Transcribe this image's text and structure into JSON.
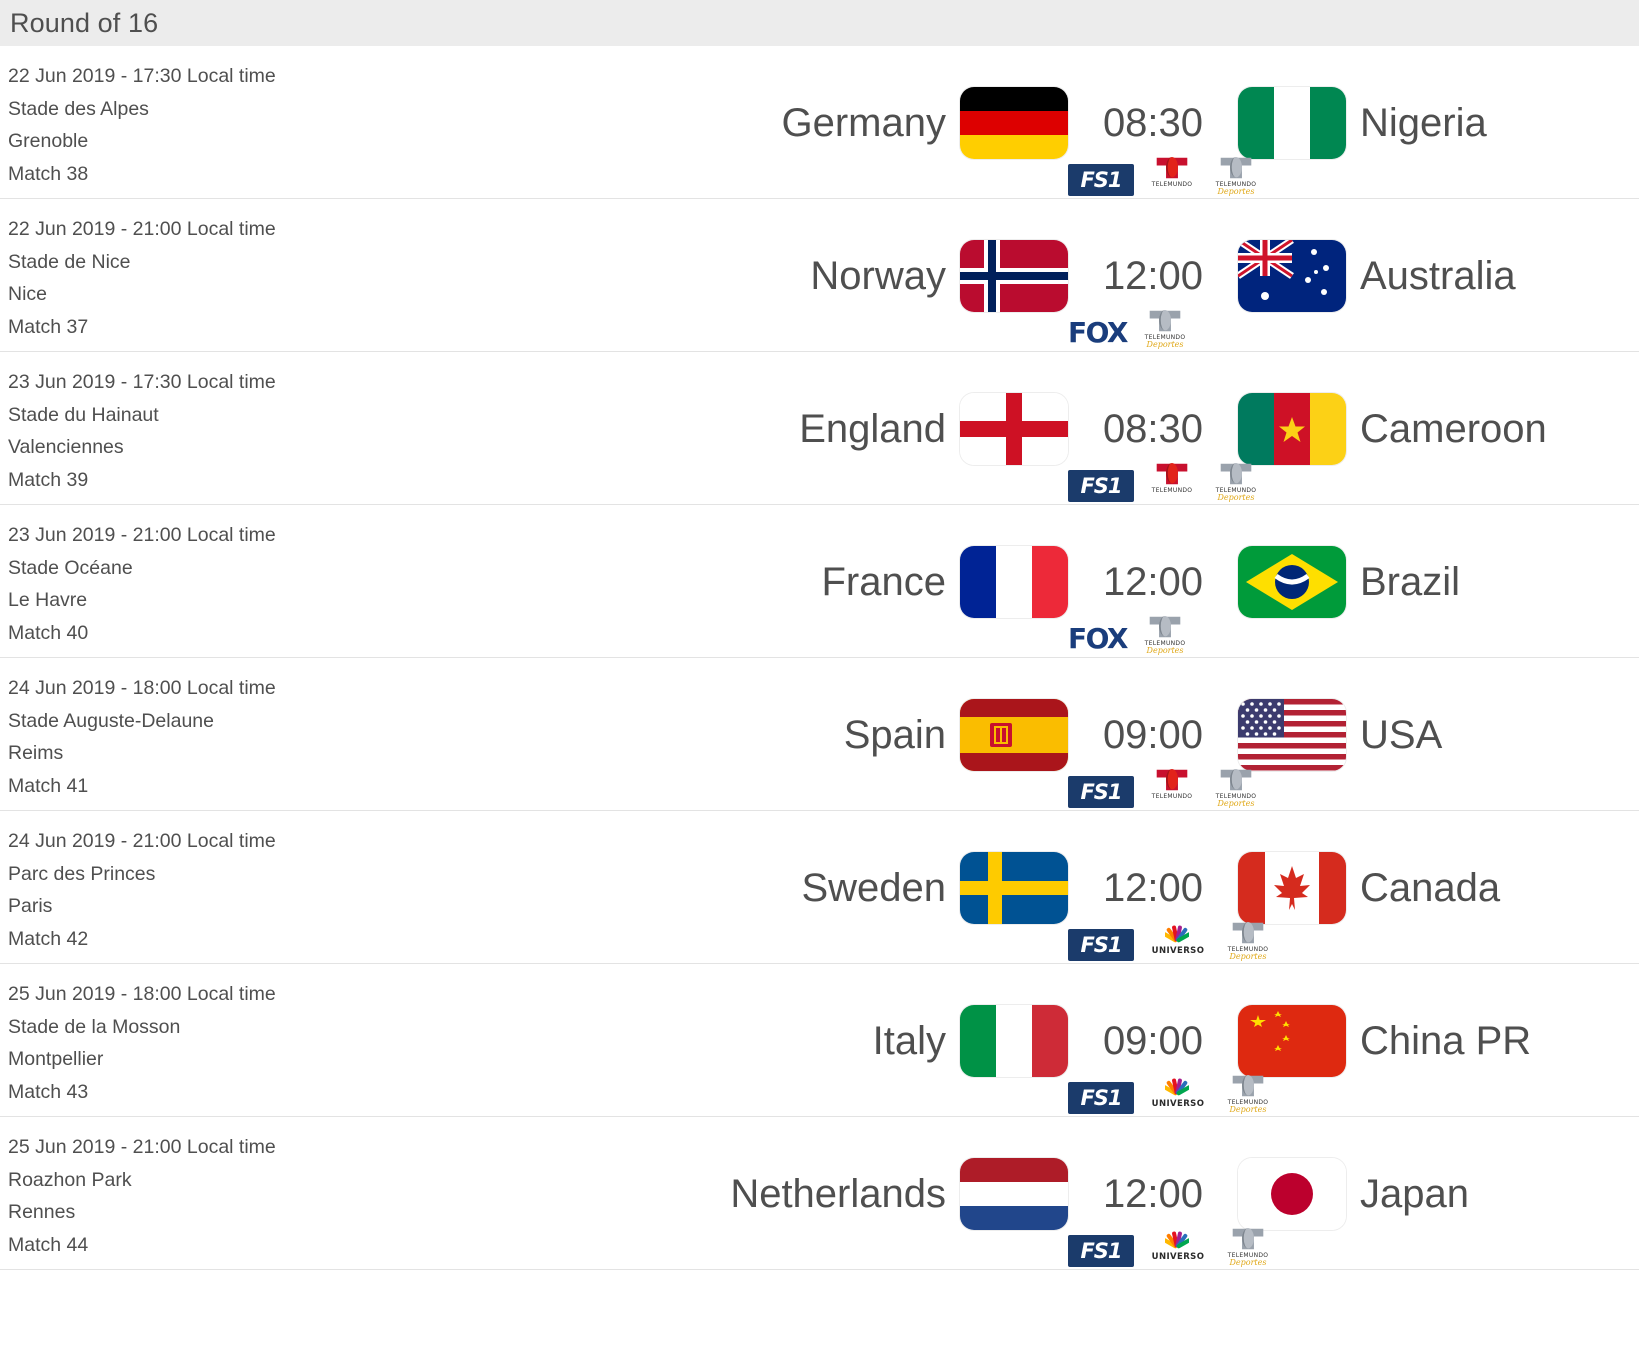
{
  "header": {
    "title": "Round of 16"
  },
  "broadcaster_names": {
    "fs1": "FS1",
    "fox": "FOX",
    "telemundo": "TELEMUNDO",
    "telemundo_deportes": "TELEMUNDO Deportes",
    "universo": "UNIVERSO"
  },
  "colors": {
    "header_bg": "#ececec",
    "text": "#4f4f4f",
    "row_divider": "#e3e3e3",
    "fs1_blue": "#1b3b6b",
    "fox_blue": "#1a3d7c",
    "telemundo_red": "#e2231a"
  },
  "matches": [
    {
      "datetime": "22 Jun 2019 - 17:30 Local time",
      "stadium": "Stade des Alpes",
      "city": "Grenoble",
      "match_no": "Match 38",
      "home": "Germany",
      "away": "Nigeria",
      "kickoff": "08:30",
      "home_flag": "germany",
      "away_flag": "nigeria",
      "broadcasters": [
        "fs1",
        "telemundo",
        "telemundo_deportes"
      ]
    },
    {
      "datetime": "22 Jun 2019 - 21:00 Local time",
      "stadium": "Stade de Nice",
      "city": "Nice",
      "match_no": "Match 37",
      "home": "Norway",
      "away": "Australia",
      "kickoff": "12:00",
      "home_flag": "norway",
      "away_flag": "australia",
      "broadcasters": [
        "fox",
        "telemundo_deportes"
      ]
    },
    {
      "datetime": "23 Jun 2019 - 17:30 Local time",
      "stadium": "Stade du Hainaut",
      "city": "Valenciennes",
      "match_no": "Match 39",
      "home": "England",
      "away": "Cameroon",
      "kickoff": "08:30",
      "home_flag": "england",
      "away_flag": "cameroon",
      "broadcasters": [
        "fs1",
        "telemundo",
        "telemundo_deportes"
      ]
    },
    {
      "datetime": "23 Jun 2019 - 21:00 Local time",
      "stadium": "Stade Océane",
      "city": "Le Havre",
      "match_no": "Match 40",
      "home": "France",
      "away": "Brazil",
      "kickoff": "12:00",
      "home_flag": "france",
      "away_flag": "brazil",
      "broadcasters": [
        "fox",
        "telemundo_deportes"
      ]
    },
    {
      "datetime": "24 Jun 2019 - 18:00 Local time",
      "stadium": "Stade Auguste-Delaune",
      "city": "Reims",
      "match_no": "Match 41",
      "home": "Spain",
      "away": "USA",
      "kickoff": "09:00",
      "home_flag": "spain",
      "away_flag": "usa",
      "broadcasters": [
        "fs1",
        "telemundo",
        "telemundo_deportes"
      ]
    },
    {
      "datetime": "24 Jun 2019 - 21:00 Local time",
      "stadium": "Parc des Princes",
      "city": "Paris",
      "match_no": "Match 42",
      "home": "Sweden",
      "away": "Canada",
      "kickoff": "12:00",
      "home_flag": "sweden",
      "away_flag": "canada",
      "broadcasters": [
        "fs1",
        "universo",
        "telemundo_deportes"
      ]
    },
    {
      "datetime": "25 Jun 2019 - 18:00 Local time",
      "stadium": "Stade de la Mosson",
      "city": "Montpellier",
      "match_no": "Match 43",
      "home": "Italy",
      "away": "China PR",
      "kickoff": "09:00",
      "home_flag": "italy",
      "away_flag": "china",
      "broadcasters": [
        "fs1",
        "universo",
        "telemundo_deportes"
      ]
    },
    {
      "datetime": "25 Jun 2019 - 21:00 Local time",
      "stadium": "Roazhon Park",
      "city": "Rennes",
      "match_no": "Match 44",
      "home": "Netherlands",
      "away": "Japan",
      "kickoff": "12:00",
      "home_flag": "netherlands",
      "away_flag": "japan",
      "broadcasters": [
        "fs1",
        "universo",
        "telemundo_deportes"
      ]
    }
  ]
}
